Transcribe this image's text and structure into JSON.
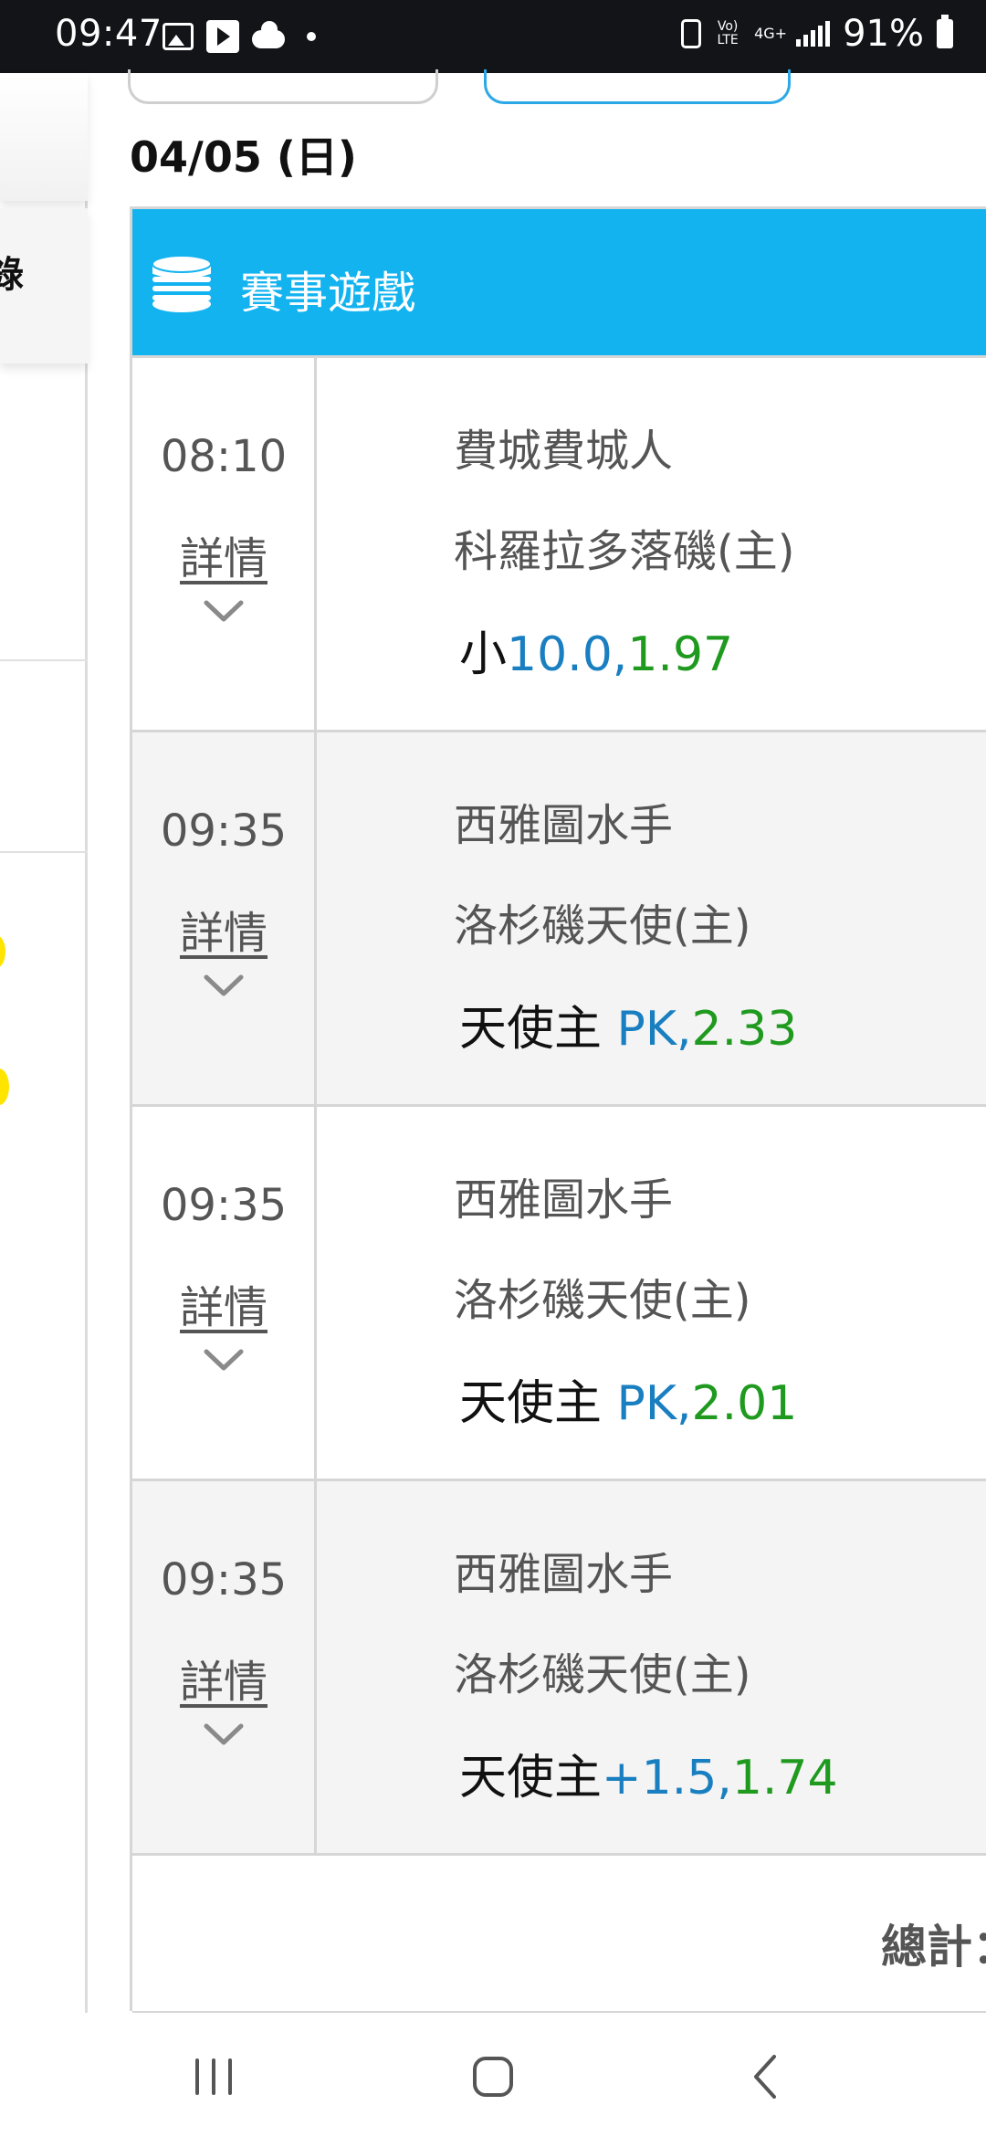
{
  "status_bar": {
    "time": "09:47",
    "battery": "91%",
    "network_volte": "Vo) LTE",
    "network_type": "4G+",
    "icons": [
      "gallery-icon",
      "video-player-icon",
      "cloud-icon",
      "notification-dot-icon",
      "sim-icon",
      "volte-icon",
      "network-4g-icon",
      "signal-icon",
      "battery-icon"
    ]
  },
  "drawer": {
    "partial_label": "錄",
    "accent_color": "#ffe400"
  },
  "date_heading": "04/05 (日)",
  "section": {
    "title": "賽事遊戲",
    "icon": "coins-stack-icon",
    "header_color": "#13b3f0"
  },
  "matches": [
    {
      "time": "08:10",
      "detail_label": "詳情",
      "away": "費城費城人",
      "home": "科羅拉多落磯(主)",
      "bet_selection": "小",
      "bet_line": "10.0,",
      "bet_odds": "1.97"
    },
    {
      "time": "09:35",
      "detail_label": "詳情",
      "away": "西雅圖水手",
      "home": "洛杉磯天使(主)",
      "bet_selection": "天使主 ",
      "bet_line": "PK,",
      "bet_odds": "2.33"
    },
    {
      "time": "09:35",
      "detail_label": "詳情",
      "away": "西雅圖水手",
      "home": "洛杉磯天使(主)",
      "bet_selection": "天使主 ",
      "bet_line": "PK,",
      "bet_odds": "2.01"
    },
    {
      "time": "09:35",
      "detail_label": "詳情",
      "away": "西雅圖水手",
      "home": "洛杉磯天使(主)",
      "bet_selection": "天使主",
      "bet_line": "+1.5,",
      "bet_odds": "1.74"
    }
  ],
  "colors": {
    "bet_line": "#1a7fc0",
    "bet_odds": "#1f9a1f"
  },
  "total_label": "總計：",
  "nav": {
    "icons": [
      "recent-apps-icon",
      "home-icon",
      "back-icon"
    ]
  }
}
